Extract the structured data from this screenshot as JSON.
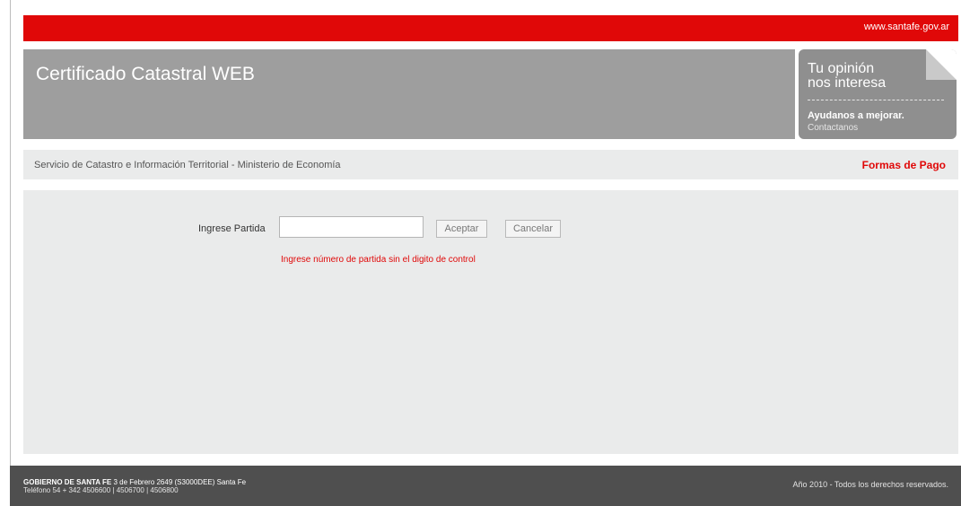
{
  "topbar": {
    "url": "www.santafe.gov.ar"
  },
  "header": {
    "title": "Certificado Catastral WEB"
  },
  "opinion": {
    "line1": "Tu opinión",
    "line2": "nos interesa",
    "line3": "Ayudanos a mejorar.",
    "line4": "Contactanos"
  },
  "subbar": {
    "service": "Servicio de Catastro e Información Territorial - Ministerio de Economía",
    "payment_link": "Formas de Pago"
  },
  "form": {
    "label": "Ingrese Partida",
    "input_value": "",
    "accept_label": "Aceptar",
    "cancel_label": "Cancelar",
    "hint": "Ingrese número de partida sin el digito de control"
  },
  "footer": {
    "org": "GOBIERNO DE SANTA FE",
    "address": " 3 de Febrero 2649 (S3000DEE) Santa Fe",
    "phone": "Teléfono 54 + 342 4506600 | 4506700 | 4506800",
    "copyright": "Año 2010 - Todos los derechos reservados."
  },
  "colors": {
    "accent": "#e00808",
    "header_gray": "#9e9e9e",
    "panel": "#eaebeb",
    "footer": "#4f4f4f"
  }
}
